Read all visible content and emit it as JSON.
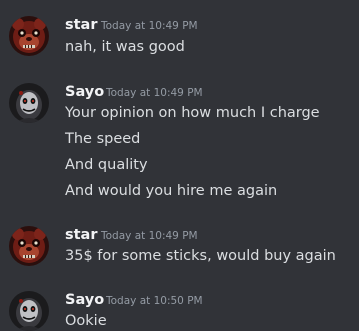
{
  "colors": {
    "background": "#313338",
    "username": "#f2f3f5",
    "timestamp": "#949ba4",
    "message_text": "#dbdee1"
  },
  "messages": [
    {
      "author": "star",
      "timestamp": "Today at 10:49 PM",
      "avatar_icon": "red-animatronic-bear-avatar-icon",
      "lines": [
        "nah, it was good"
      ]
    },
    {
      "author": "Sayo",
      "timestamp": "Today at 10:49 PM",
      "avatar_icon": "dark-figure-avatar-icon",
      "lines": [
        "Your opinion on how much I charge",
        "The speed",
        "And quality",
        "And would you hire me again"
      ]
    },
    {
      "author": "star",
      "timestamp": "Today at 10:49 PM",
      "avatar_icon": "red-animatronic-bear-avatar-icon",
      "lines": [
        "35$ for some sticks, would buy again"
      ]
    },
    {
      "author": "Sayo",
      "timestamp": "Today at 10:50 PM",
      "avatar_icon": "dark-figure-avatar-icon",
      "lines": [
        "Ookie"
      ]
    }
  ]
}
